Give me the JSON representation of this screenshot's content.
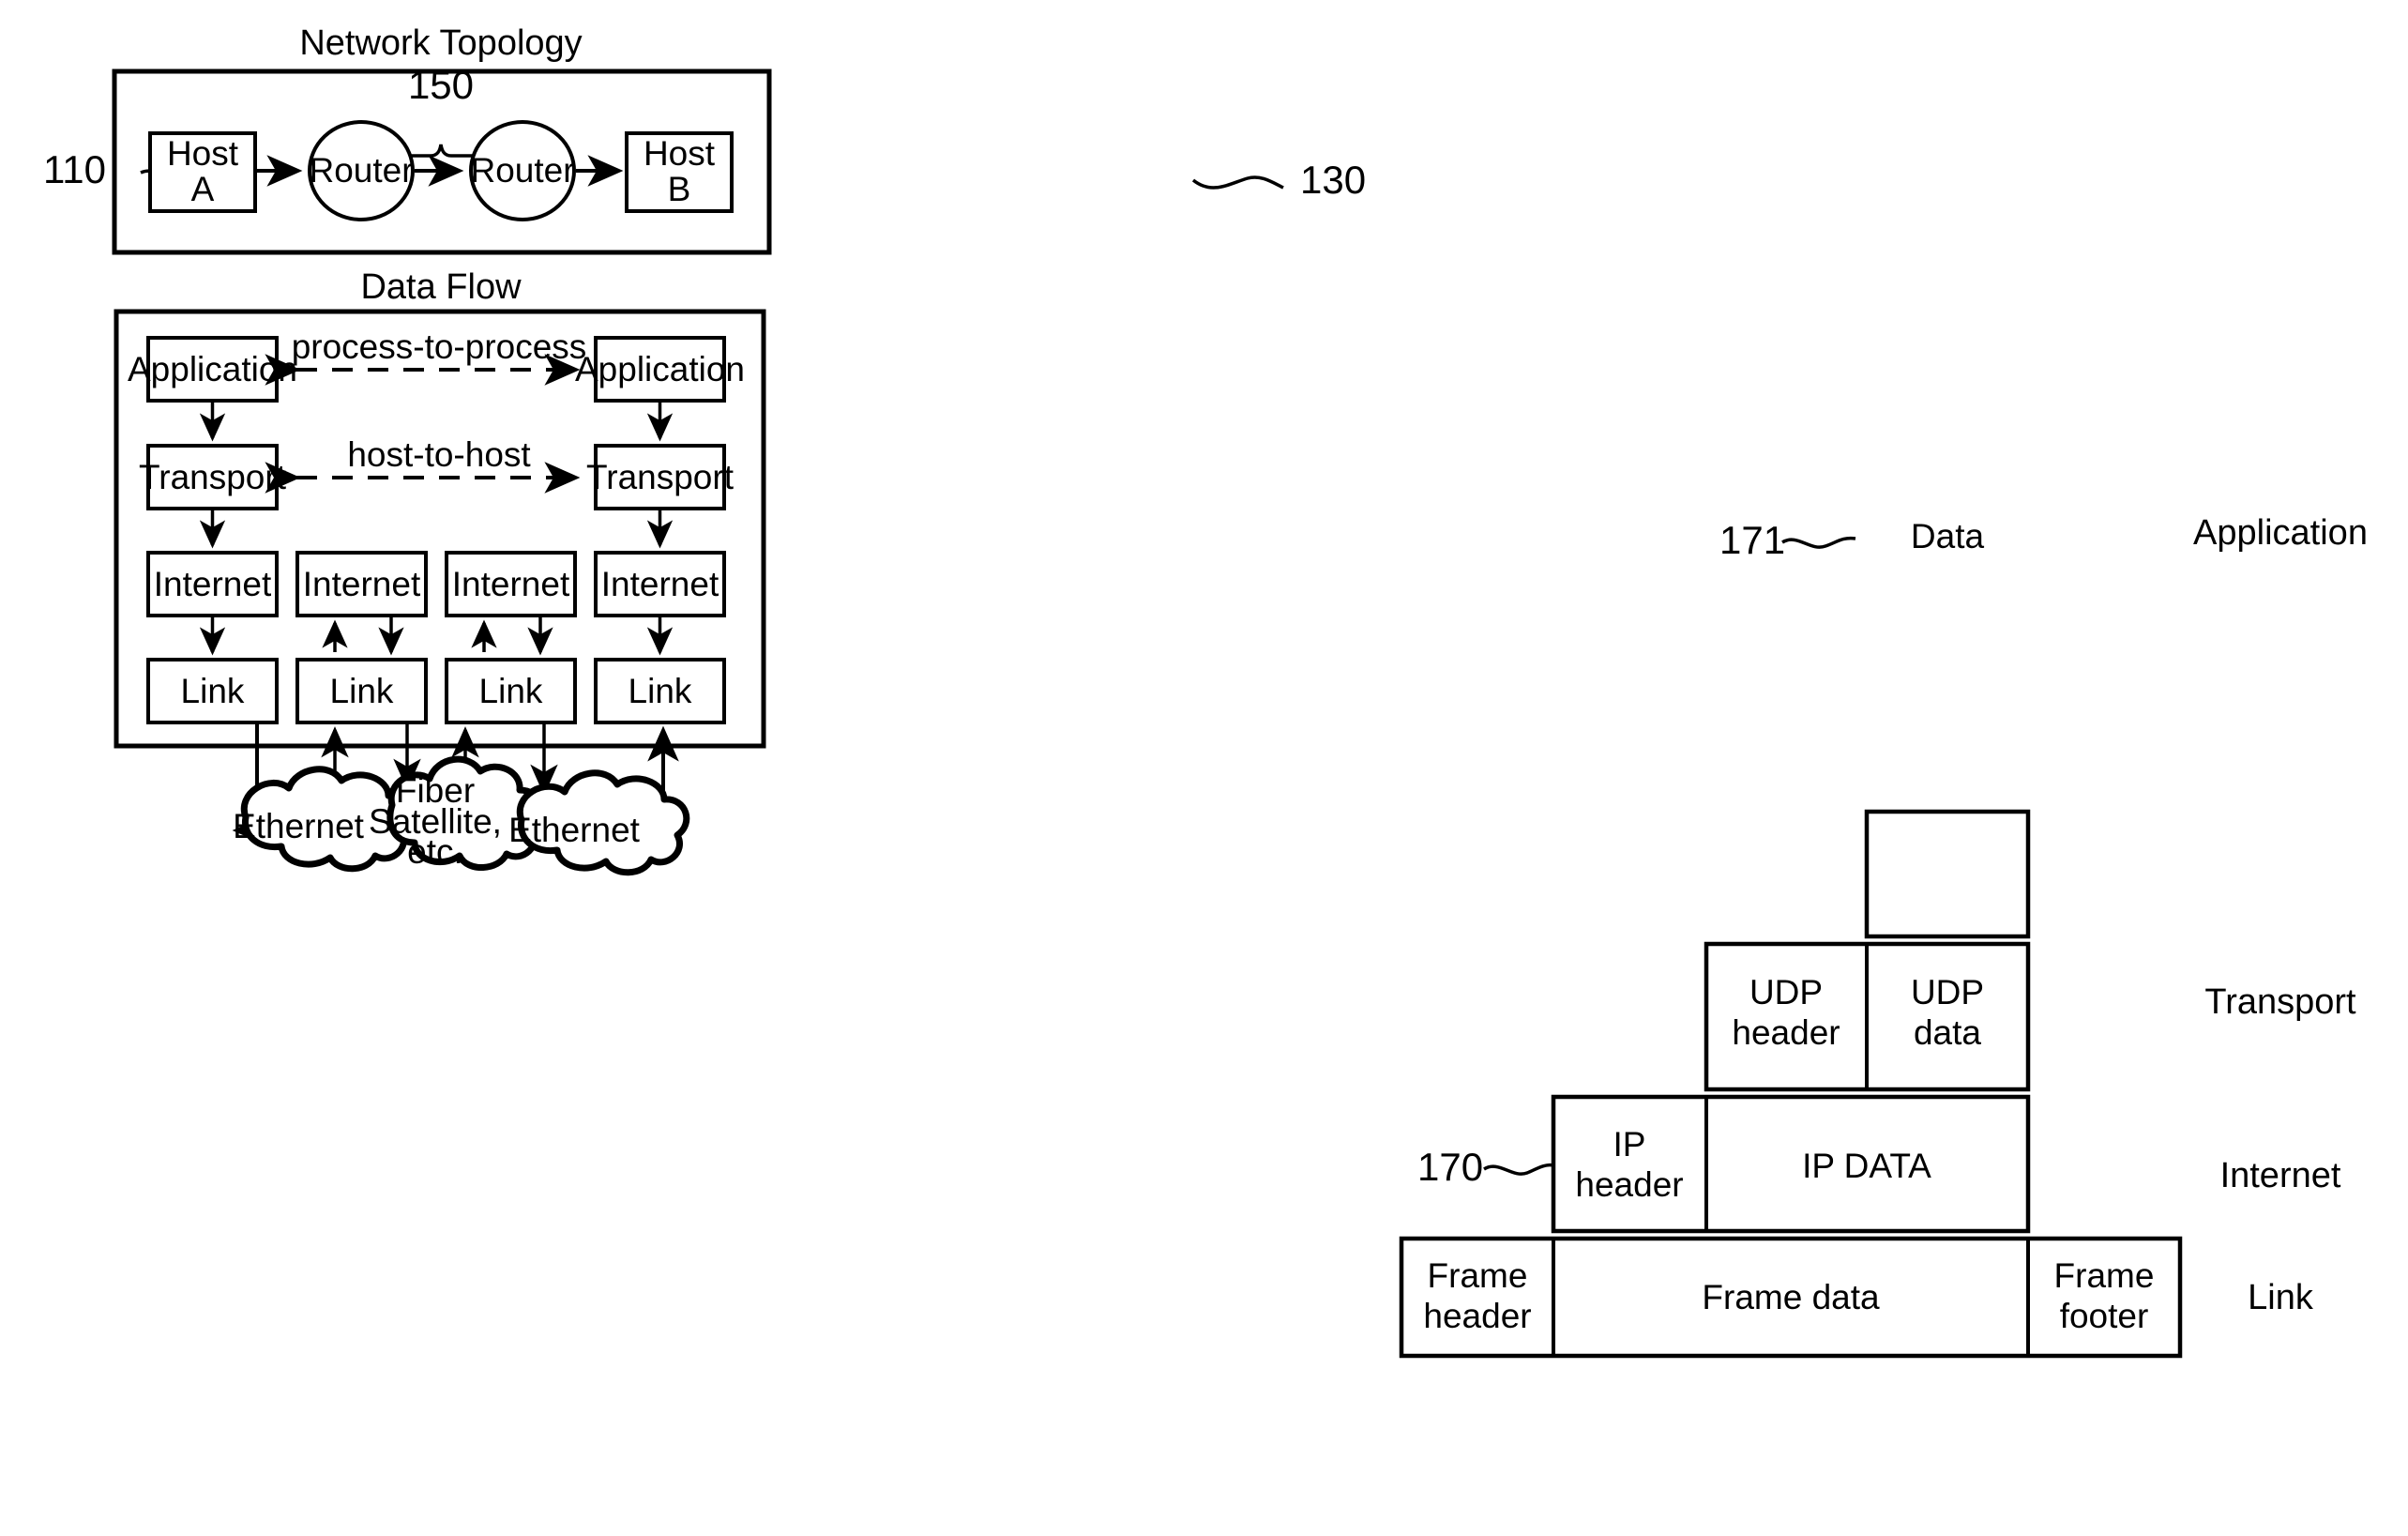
{
  "figure": {
    "title_top": "Network Topology",
    "title_middle": "Data Flow"
  },
  "network_topology": {
    "caption": "Network Topology",
    "ref_left": "110",
    "ref_right": "130",
    "ref_routers": "150",
    "nodes": [
      {
        "id": "host-a",
        "label_line1": "Host",
        "label_line2": "A",
        "shape": "rect"
      },
      {
        "id": "router-1",
        "label_line1": "Router",
        "label_line2": "",
        "shape": "ellipse"
      },
      {
        "id": "router-2",
        "label_line1": "Router",
        "label_line2": "",
        "shape": "ellipse"
      },
      {
        "id": "host-b",
        "label_line1": "Host",
        "label_line2": "B",
        "shape": "rect"
      }
    ]
  },
  "data_flow": {
    "caption": "Data Flow",
    "peer_labels": [
      {
        "id": "process-to-process",
        "text": "process-to-process"
      },
      {
        "id": "host-to-host",
        "text": "host-to-host"
      }
    ],
    "columns": [
      {
        "id": "col-1",
        "layers": [
          {
            "id": "application",
            "label": "Application"
          },
          {
            "id": "transport",
            "label": "Transport"
          },
          {
            "id": "internet",
            "label": "Internet"
          },
          {
            "id": "link",
            "label": "Link"
          }
        ]
      },
      {
        "id": "col-2",
        "layers": [
          {
            "id": "internet",
            "label": "Internet"
          },
          {
            "id": "link",
            "label": "Link"
          }
        ]
      },
      {
        "id": "col-3",
        "layers": [
          {
            "id": "internet",
            "label": "Internet"
          },
          {
            "id": "link",
            "label": "Link"
          }
        ]
      },
      {
        "id": "col-4",
        "layers": [
          {
            "id": "application",
            "label": "Application"
          },
          {
            "id": "transport",
            "label": "Transport"
          },
          {
            "id": "internet",
            "label": "Internet"
          },
          {
            "id": "link",
            "label": "Link"
          }
        ]
      }
    ],
    "clouds": [
      {
        "id": "cloud-ethernet-left",
        "line1": "Ethernet",
        "line2": "",
        "line3": ""
      },
      {
        "id": "cloud-fiber-satellite",
        "line1": "Fiber",
        "line2": "Satellite,",
        "line3": "etc."
      },
      {
        "id": "cloud-ethernet-right",
        "line1": "Ethernet",
        "line2": "",
        "line3": ""
      }
    ]
  },
  "encapsulation": {
    "ref_data": "171",
    "ref_ip": "170",
    "layer_labels": [
      {
        "id": "application",
        "text": "Application"
      },
      {
        "id": "transport",
        "text": "Transport"
      },
      {
        "id": "internet",
        "text": "Internet"
      },
      {
        "id": "link",
        "text": "Link"
      }
    ],
    "rows": [
      {
        "id": "application-row",
        "cells": [
          {
            "id": "data",
            "text": "Data"
          }
        ]
      },
      {
        "id": "transport-row",
        "cells": [
          {
            "id": "udp-header",
            "line1": "UDP",
            "line2": "header"
          },
          {
            "id": "udp-data",
            "line1": "UDP",
            "line2": "data"
          }
        ]
      },
      {
        "id": "internet-row",
        "cells": [
          {
            "id": "ip-header",
            "line1": "IP",
            "line2": "header"
          },
          {
            "id": "ip-data",
            "line1": "IP DATA",
            "line2": ""
          }
        ]
      },
      {
        "id": "link-row",
        "cells": [
          {
            "id": "frame-header",
            "line1": "Frame",
            "line2": "header"
          },
          {
            "id": "frame-data",
            "line1": "Frame data",
            "line2": ""
          },
          {
            "id": "frame-footer",
            "line1": "Frame",
            "line2": "footer"
          }
        ]
      }
    ]
  },
  "colors": {
    "ink": "#000000",
    "paper": "#ffffff"
  }
}
